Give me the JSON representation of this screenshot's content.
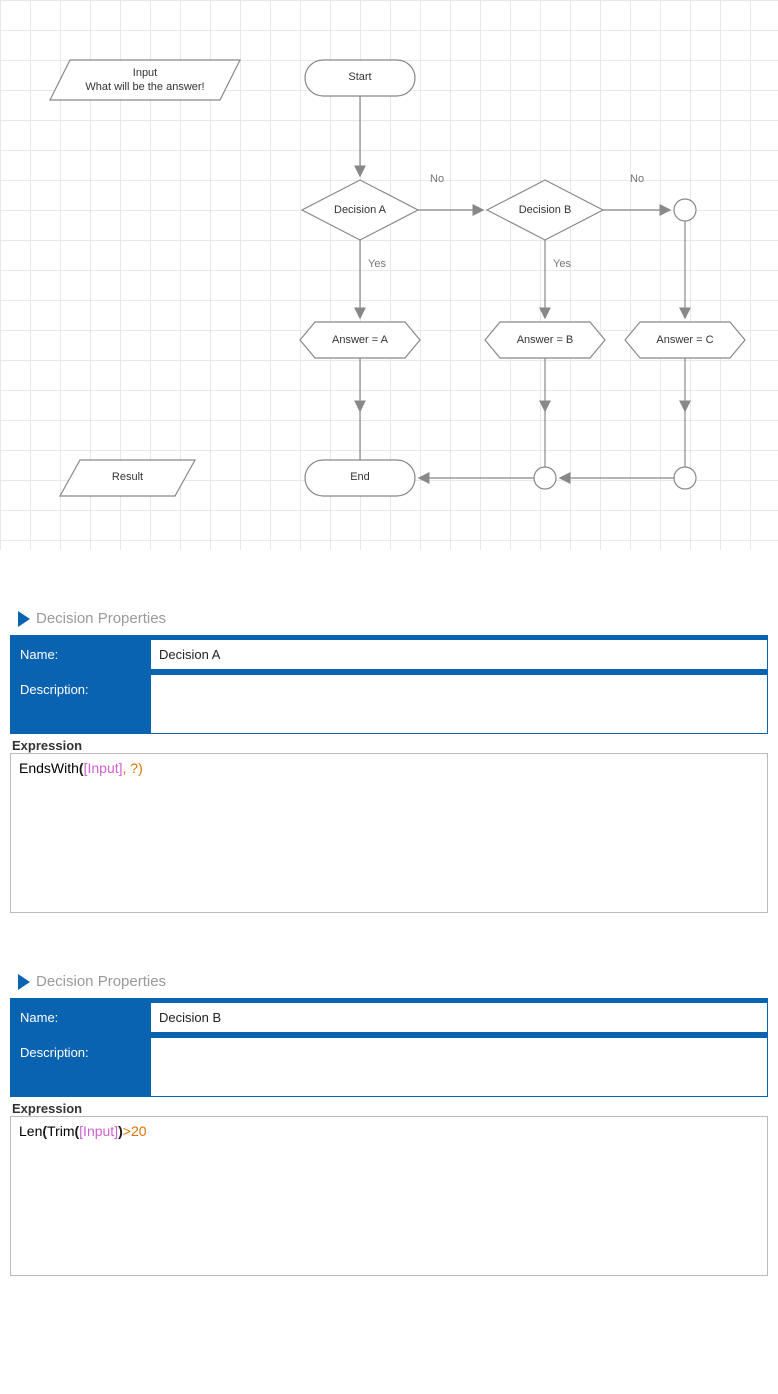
{
  "flowchart": {
    "input": {
      "line1": "Input",
      "line2": "What will be the answer!"
    },
    "start": "Start",
    "decisionA": "Decision A",
    "decisionB": "Decision B",
    "answerA": "Answer = A",
    "answerB": "Answer = B",
    "answerC": "Answer = C",
    "end": "End",
    "result": "Result",
    "labels": {
      "yes": "Yes",
      "no": "No"
    }
  },
  "panel1": {
    "title": "Decision Properties",
    "nameLabel": "Name:",
    "nameValue": "Decision A",
    "descLabel": "Description:",
    "descValue": "",
    "exprLabel": "Expression",
    "expr": {
      "fn": "EndsWith",
      "var": "[Input]",
      "tail": ", ?)"
    }
  },
  "panel2": {
    "title": "Decision Properties",
    "nameLabel": "Name:",
    "nameValue": "Decision B",
    "descLabel": "Description:",
    "descValue": "",
    "exprLabel": "Expression",
    "expr": {
      "fn1": "Len",
      "fn2": "Trim",
      "var": "[Input]",
      "op": ">",
      "num": "20"
    }
  }
}
